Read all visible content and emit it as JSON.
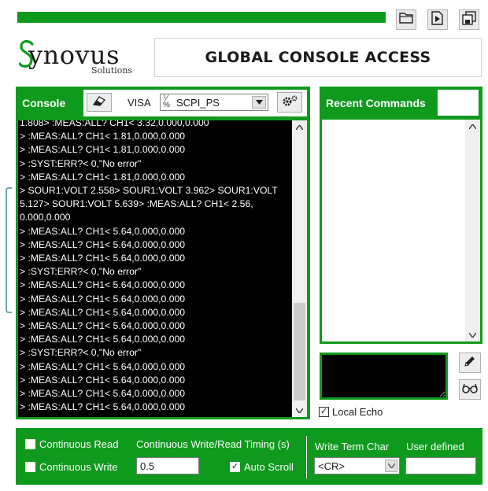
{
  "progress": {
    "fraction": 1.0,
    "color": "#0d9a1a"
  },
  "toolbar": {
    "icons": [
      "folder-open-icon",
      "export-icon",
      "save-copy-icon"
    ]
  },
  "brand": {
    "logo_text": "ynovus",
    "logo_sub": "Solutions",
    "title": "GLOBAL CONSOLE ACCESS",
    "accent": "#0f9a1e"
  },
  "console": {
    "label": "Console",
    "visa_label": "VISA",
    "resource": "SCPI_PS",
    "lines": [
      "1.808> :MEAS:ALL? CH1< 3.32,0.000,0.000",
      "> :MEAS:ALL? CH1< 1.81,0.000,0.000",
      "> :MEAS:ALL? CH1< 1.81,0.000,0.000",
      "> :SYST:ERR?< 0,\"No error\"",
      "> :MEAS:ALL? CH1< 1.81,0.000,0.000",
      "> SOUR1:VOLT 2.558> SOUR1:VOLT 3.962> SOUR1:VOLT",
      "5.127> SOUR1:VOLT 5.639> :MEAS:ALL? CH1< 2.56,",
      "0.000,0.000",
      "> :MEAS:ALL? CH1< 5.64,0.000,0.000",
      "> :MEAS:ALL? CH1< 5.64,0.000,0.000",
      "> :MEAS:ALL? CH1< 5.64,0.000,0.000",
      "> :SYST:ERR?< 0,\"No error\"",
      "> :MEAS:ALL? CH1< 5.64,0.000,0.000",
      "> :MEAS:ALL? CH1< 5.64,0.000,0.000",
      "> :MEAS:ALL? CH1< 5.64,0.000,0.000",
      "> :MEAS:ALL? CH1< 5.64,0.000,0.000",
      "> :MEAS:ALL? CH1< 5.64,0.000,0.000",
      "> :SYST:ERR?< 0,\"No error\"",
      "> :MEAS:ALL? CH1< 5.64,0.000,0.000",
      "> :MEAS:ALL? CH1< 5.64,0.000,0.000",
      "> :MEAS:ALL? CH1< 5.64,0.000,0.000",
      "> :MEAS:ALL? CH1< 5.64,0.000,0.000"
    ]
  },
  "recent": {
    "label": "Recent Commands"
  },
  "local_echo": {
    "label": "Local Echo",
    "checked": true
  },
  "bottom": {
    "continuous_read": {
      "label": "Continuous Read",
      "checked": false
    },
    "continuous_write": {
      "label": "Continuous Write",
      "checked": false
    },
    "timing_label": "Continuous Write/Read Timing (s)",
    "timing_value": "0.5",
    "auto_scroll": {
      "label": "Auto Scroll",
      "checked": true
    },
    "term_char_label": "Write Term Char",
    "term_char_value": "<CR>",
    "user_defined_label": "User defined",
    "user_defined_value": ""
  }
}
